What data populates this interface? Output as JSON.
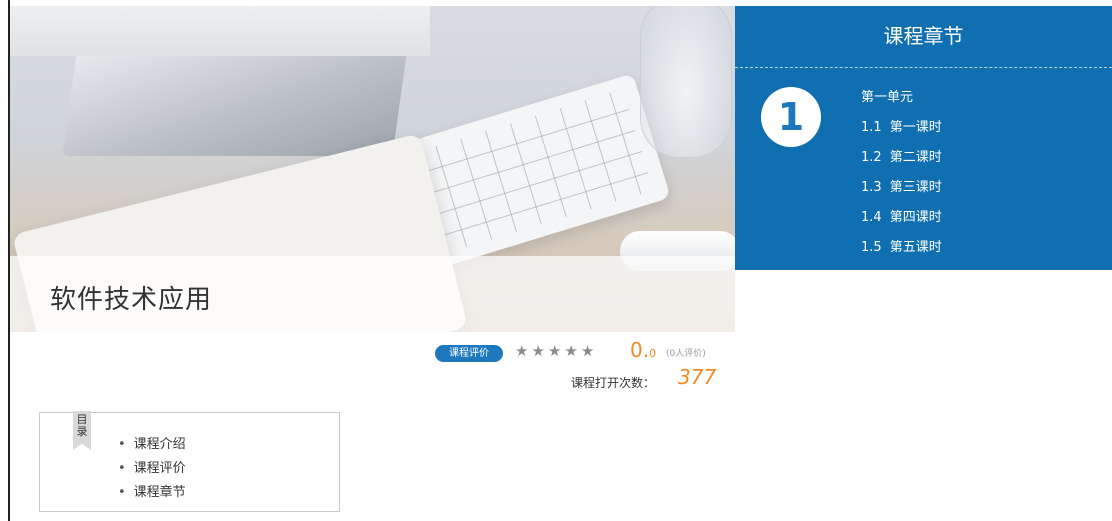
{
  "course": {
    "title": "软件技术应用"
  },
  "chapters": {
    "title": "课程章节",
    "unit_number": "1",
    "unit_name": "第一单元",
    "lessons": [
      {
        "num": "1.1",
        "name": "第一课时"
      },
      {
        "num": "1.2",
        "name": "第二课时"
      },
      {
        "num": "1.3",
        "name": "第三课时"
      },
      {
        "num": "1.4",
        "name": "第四课时"
      },
      {
        "num": "1.5",
        "name": "第五课时"
      }
    ]
  },
  "rating": {
    "badge": "课程评价",
    "stars_filled": 0,
    "stars_total": 5,
    "score_main": "0.",
    "score_decimal": "0",
    "raters": "(0人评价)",
    "opens_label": "课程打开次数：",
    "opens_value": "377"
  },
  "toc": {
    "ribbon": "目录",
    "items": [
      "课程介绍",
      "课程评价",
      "课程章节"
    ]
  },
  "colors": {
    "accent": "#1d78bd",
    "panel": "#0f6fb0",
    "highlight": "#f08a24"
  }
}
